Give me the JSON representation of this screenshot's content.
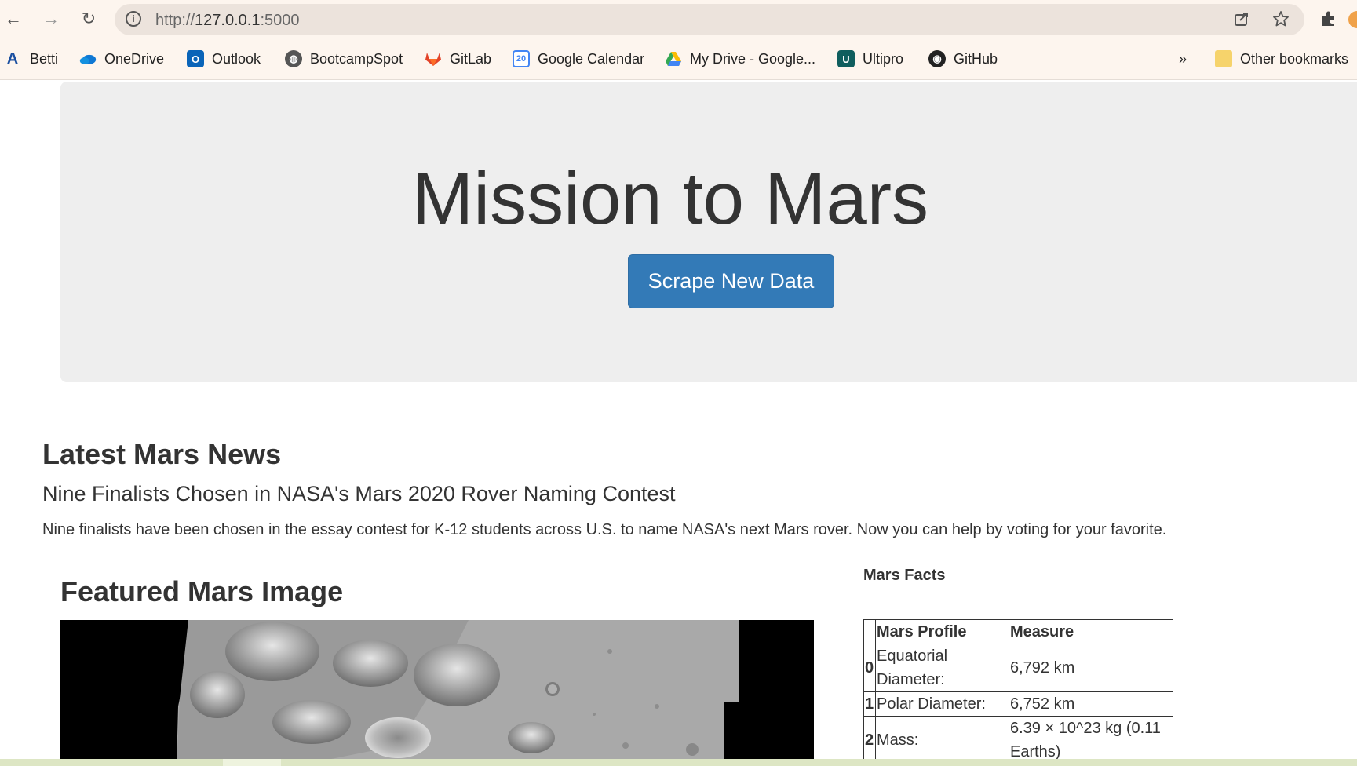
{
  "browser": {
    "url_base": "http://",
    "url_host": "127.0.0.1",
    "url_port": ":5000",
    "nav": {
      "back_icon": "←",
      "forward_icon": "→",
      "reload_icon": "↻"
    },
    "bookmarks": [
      {
        "label": "Betti",
        "icon": "betti-icon",
        "color": "#1a4fa0"
      },
      {
        "label": "OneDrive",
        "icon": "onedrive-icon",
        "color": "#0f78d4"
      },
      {
        "label": "Outlook",
        "icon": "outlook-icon",
        "color": "#0a64b8"
      },
      {
        "label": "BootcampSpot",
        "icon": "globe-icon",
        "color": "#555555"
      },
      {
        "label": "GitLab",
        "icon": "gitlab-icon",
        "color": "#e24329"
      },
      {
        "label": "Google Calendar",
        "icon": "calendar-icon",
        "color": "#4285f4",
        "badge": "20"
      },
      {
        "label": "My Drive - Google...",
        "icon": "drive-icon",
        "color": "#34a853"
      },
      {
        "label": "Ultipro",
        "icon": "ultipro-icon",
        "color": "#0f5e5e"
      },
      {
        "label": "GitHub",
        "icon": "github-icon",
        "color": "#222222"
      }
    ],
    "overflow_label": "»",
    "other_bookmarks": "Other bookmarks"
  },
  "jumbotron": {
    "title": "Mission to Mars",
    "button_label": "Scrape New Data",
    "accent": "#337ab7"
  },
  "news": {
    "heading": "Latest Mars News",
    "title": "Nine Finalists Chosen in NASA's Mars 2020 Rover Naming Contest",
    "paragraph": "Nine finalists have been chosen in the essay contest for K-12 students across U.S. to name NASA's next Mars rover. Now you can help by voting for your favorite."
  },
  "featured": {
    "heading": "Featured Mars Image"
  },
  "facts": {
    "heading": "Mars Facts",
    "columns": [
      "",
      "Mars Profile",
      "Measure"
    ],
    "rows": [
      {
        "idx": "0",
        "profile": "Equatorial Diameter:",
        "measure": "6,792 km"
      },
      {
        "idx": "1",
        "profile": "Polar Diameter:",
        "measure": "6,752 km"
      },
      {
        "idx": "2",
        "profile": "Mass:",
        "measure": "6.39 × 10^23 kg (0.11 Earths)"
      }
    ]
  }
}
